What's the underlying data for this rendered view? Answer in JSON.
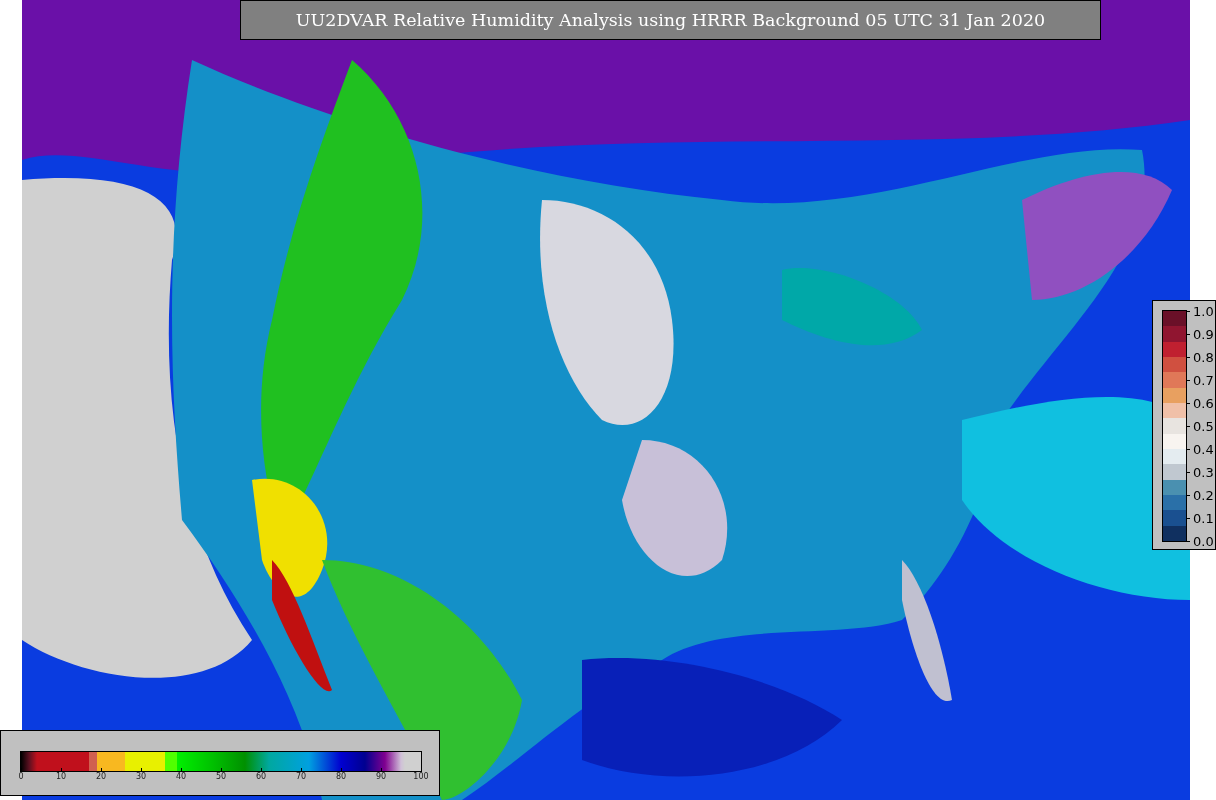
{
  "title": "UU2DVAR Relative Humidity Analysis using HRRR Background 05 UTC 31 Jan 2020",
  "error_colorbar": {
    "ticks": [
      "1.0",
      "0.9",
      "0.8",
      "0.7",
      "0.6",
      "0.5",
      "0.4",
      "0.3",
      "0.2",
      "0.1",
      "0.0"
    ]
  },
  "humidity_colorbar": {
    "ticks": [
      "0",
      "10",
      "20",
      "30",
      "40",
      "50",
      "60",
      "70",
      "80",
      "90",
      "100"
    ]
  }
}
